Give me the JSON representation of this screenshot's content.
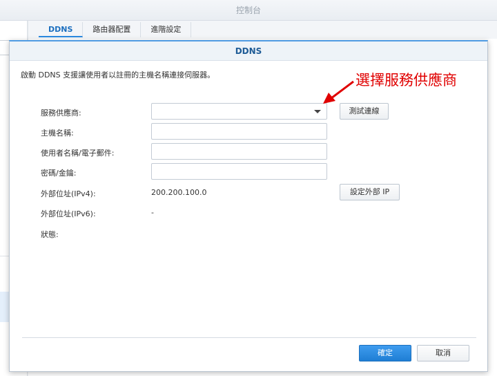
{
  "window": {
    "title": "控制台"
  },
  "tabs": [
    {
      "label": "DDNS"
    },
    {
      "label": "路由器配置"
    },
    {
      "label": "進階設定"
    }
  ],
  "dialog": {
    "title": "DDNS",
    "description": "啟動 DDNS 支援讓使用者以註冊的主機名稱連接伺服器。",
    "fields": {
      "provider": {
        "label": "服務供應商:",
        "value": ""
      },
      "hostname": {
        "label": "主機名稱:",
        "value": ""
      },
      "username": {
        "label": "使用者名稱/電子郵件:",
        "value": ""
      },
      "password": {
        "label": "密碼/金鑰:",
        "value": ""
      },
      "ipv4": {
        "label": "外部位址(IPv4):",
        "value": "200.200.100.0"
      },
      "ipv6": {
        "label": "外部位址(IPv6):",
        "value": "-"
      },
      "status": {
        "label": "狀態:",
        "value": ""
      }
    },
    "buttons": {
      "test": "測試連線",
      "set_external_ip": "設定外部 IP",
      "ok": "確定",
      "cancel": "取消"
    }
  },
  "annotation": {
    "text": "選擇服務供應商",
    "color": "#e00000"
  },
  "colors": {
    "accent": "#1f7ed4",
    "tab_active": "#1c6fbf"
  }
}
